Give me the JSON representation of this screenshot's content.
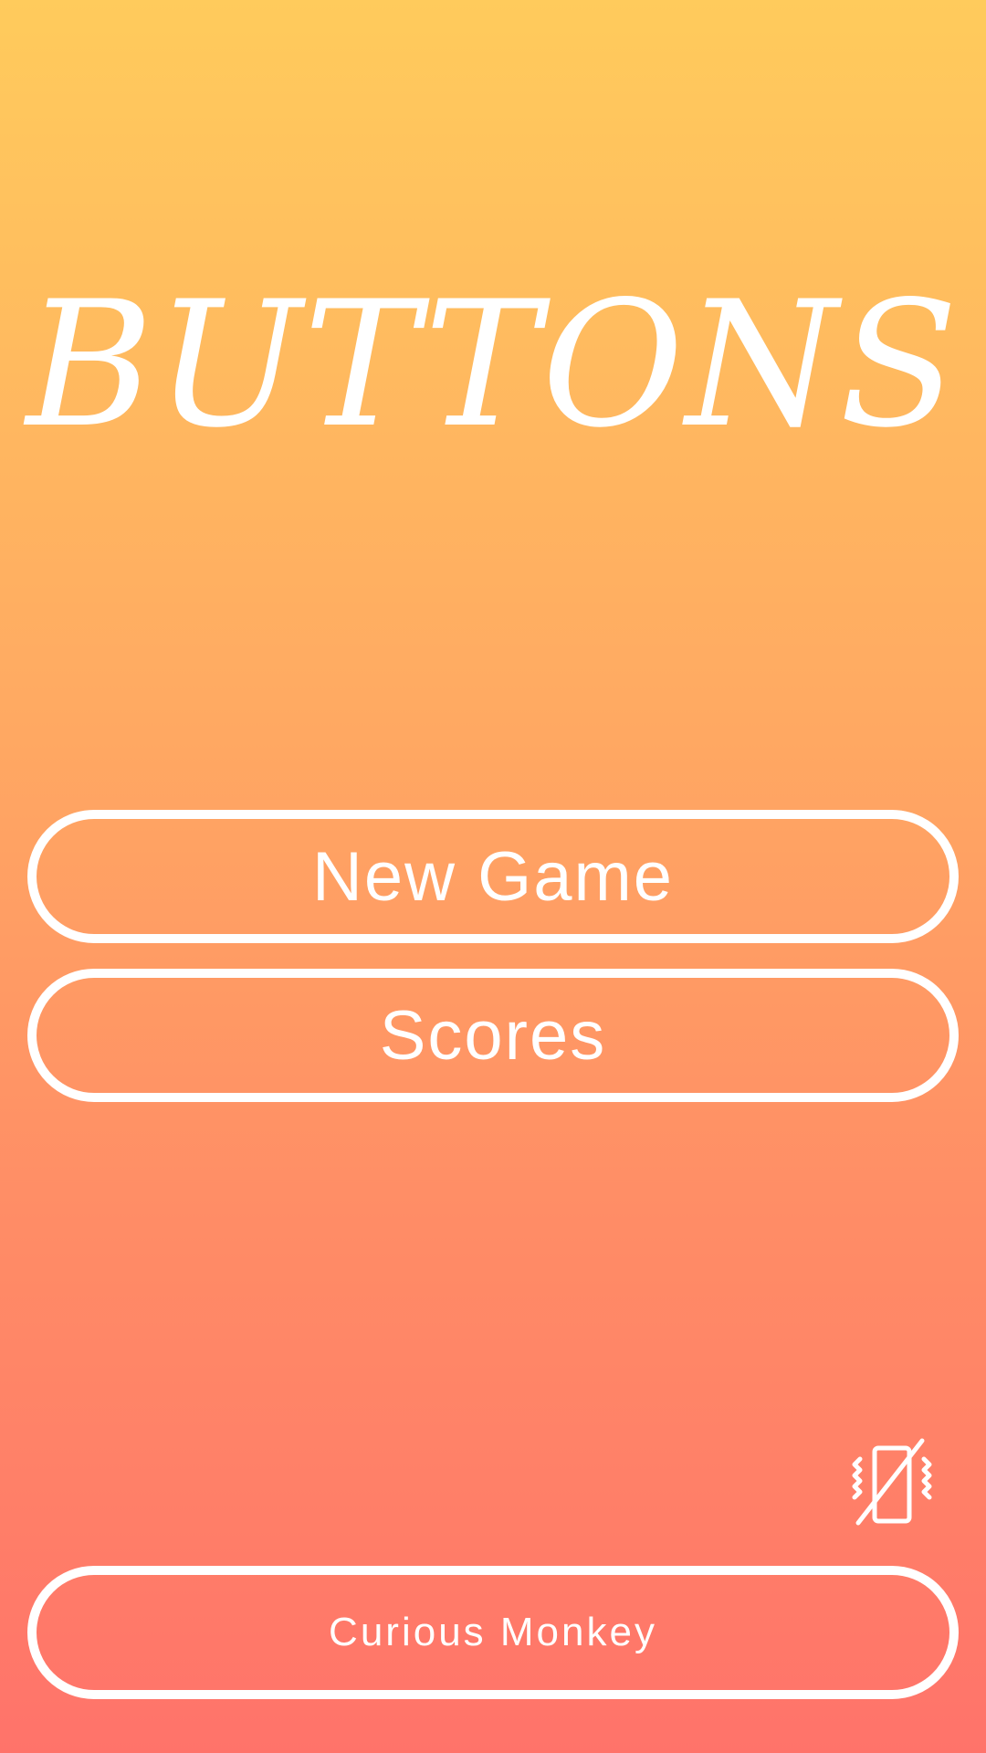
{
  "app": {
    "title": "BUTTONS"
  },
  "menu": {
    "new_game_label": "New Game",
    "scores_label": "Scores"
  },
  "settings": {
    "vibration_icon": "vibration-off-icon"
  },
  "footer": {
    "developer_label": "Curious Monkey"
  },
  "colors": {
    "gradient_top": "#ffcb5c",
    "gradient_bottom": "#ff736a",
    "foreground": "#ffffff"
  }
}
